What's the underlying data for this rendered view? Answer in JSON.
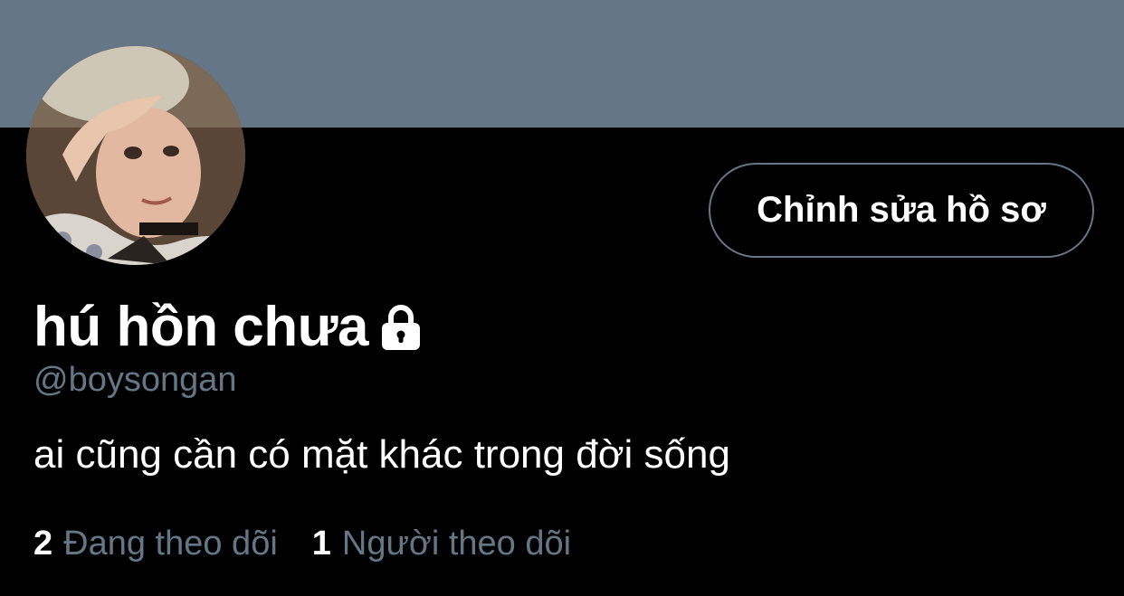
{
  "profile": {
    "display_name": "hú hồn chưa",
    "handle": "@boysongan",
    "bio": "ai cũng cần có mặt khác trong đời sống",
    "protected_icon": "lock-icon",
    "avatar_icon": "avatar"
  },
  "actions": {
    "edit_profile_label": "Chỉnh sửa hồ sơ"
  },
  "stats": {
    "following_count": "2",
    "following_label": "Đang theo dõi",
    "followers_count": "1",
    "followers_label": "Người theo dõi"
  },
  "colors": {
    "background": "#000000",
    "banner": "#657786",
    "secondary_text": "#657786",
    "primary_text": "#ffffff"
  }
}
